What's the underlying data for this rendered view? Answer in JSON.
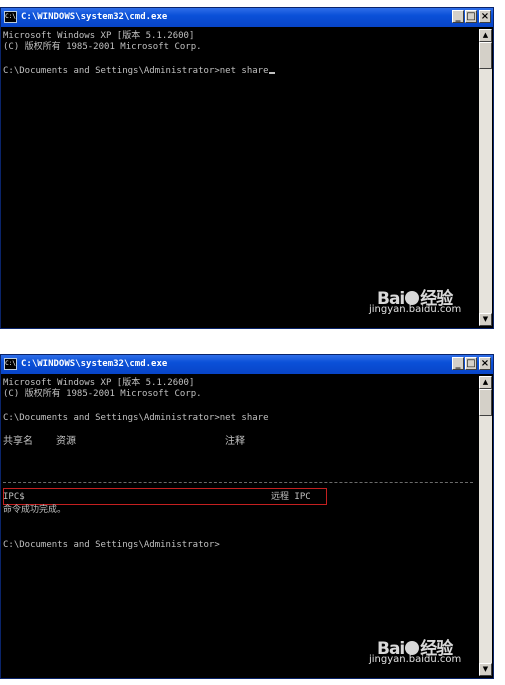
{
  "windows": [
    {
      "title": "C:\\WINDOWS\\system32\\cmd.exe",
      "icon": "cmd-icon",
      "controls": {
        "minimize": "_",
        "maximize": "□",
        "close": "×"
      },
      "scroll": {
        "up": "▲",
        "down": "▼"
      },
      "lines": [
        "Microsoft Windows XP [版本 5.1.2600]",
        "(C) 版权所有 1985-2001 Microsoft Corp.",
        "C:\\Documents and Settings\\Administrator>net share"
      ],
      "watermark": {
        "logo_a": "Bai",
        "logo_b": "经验",
        "url": "jingyan.baidu.com"
      }
    },
    {
      "title": "C:\\WINDOWS\\system32\\cmd.exe",
      "icon": "cmd-icon",
      "controls": {
        "minimize": "_",
        "maximize": "□",
        "close": "×"
      },
      "scroll": {
        "up": "▲",
        "down": "▼"
      },
      "lines": [
        "Microsoft Windows XP [版本 5.1.2600]",
        "(C) 版权所有 1985-2001 Microsoft Corp.",
        "C:\\Documents and Settings\\Administrator>net share"
      ],
      "share_headers": {
        "name": "共享名",
        "resource": "资源",
        "remark": "注释"
      },
      "share_row": {
        "name": "IPC$",
        "remark": "远程 IPC"
      },
      "result": "命令成功完成。",
      "prompt": "C:\\Documents and Settings\\Administrator>",
      "watermark": {
        "logo_a": "Bai",
        "logo_b": "经验",
        "url": "jingyan.baidu.com"
      }
    }
  ]
}
